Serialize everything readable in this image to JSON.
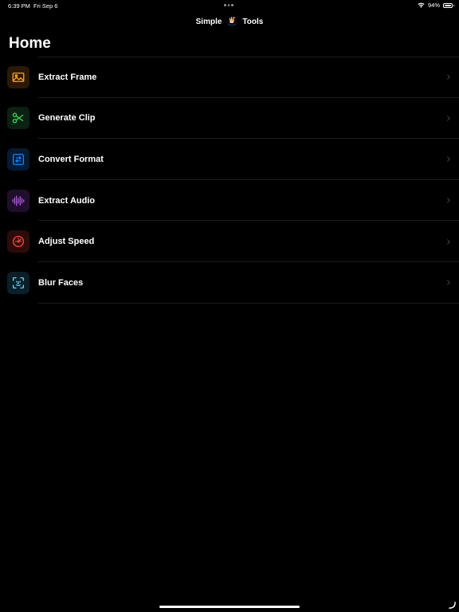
{
  "status_bar": {
    "time": "6:39 PM",
    "date": "Fri Sep 6",
    "battery_label": "94%",
    "battery_level": 0.94
  },
  "nav": {
    "title_left": "Simple",
    "title_right": "Tools",
    "logo_icon": "fish-hand-logo-icon"
  },
  "page": {
    "title": "Home"
  },
  "colors": {
    "orange": "#ff9f0a",
    "green": "#30d158",
    "blue": "#0a84ff",
    "purple": "#bf5af2",
    "red": "#ff453a",
    "teal": "#64d2ff"
  },
  "tools": [
    {
      "label": "Extract Frame",
      "icon": "photo-icon"
    },
    {
      "label": "Generate Clip",
      "icon": "scissors-icon"
    },
    {
      "label": "Convert Format",
      "icon": "convert-arrows-icon"
    },
    {
      "label": "Extract Audio",
      "icon": "waveform-icon"
    },
    {
      "label": "Adjust Speed",
      "icon": "speedometer-icon"
    },
    {
      "label": "Blur Faces",
      "icon": "face-scan-icon"
    }
  ]
}
